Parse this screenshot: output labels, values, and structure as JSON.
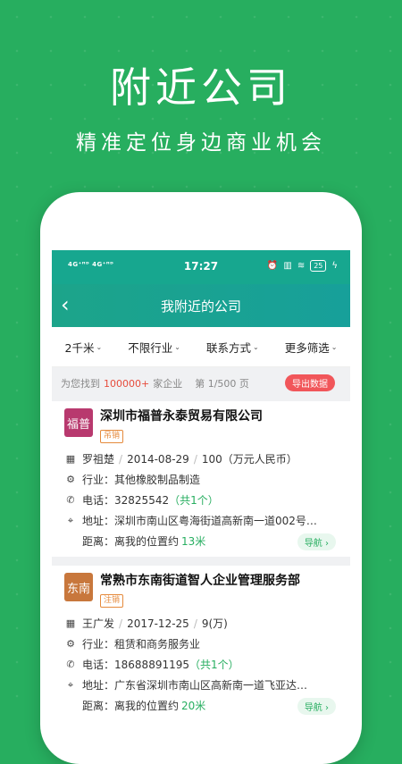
{
  "promo": {
    "title": "附近公司",
    "subtitle": "精准定位身边商业机会"
  },
  "statusbar": {
    "left": "4G⁺ᴴᴰ 4G⁺ᴴᴰ",
    "time": "17:27",
    "battery": "25"
  },
  "nav": {
    "title": "我附近的公司"
  },
  "filters": [
    {
      "label": "2千米"
    },
    {
      "label": "不限行业"
    },
    {
      "label": "联系方式"
    },
    {
      "label": "更多筛选"
    }
  ],
  "result": {
    "prefix": "为您找到",
    "count": "100000+",
    "suffix": "家企业",
    "page": "第 1/500 页",
    "export_label": "导出数据"
  },
  "companies": [
    {
      "logo_text": "福普",
      "logo_color": "#b8396e",
      "name": "深圳市福普永泰贸易有限公司",
      "tag": "吊销",
      "person": "罗祖楚",
      "date": "2014-08-29",
      "capital": "100（万元人民币）",
      "industry_label": "行业：",
      "industry": "其他橡胶制品制造",
      "phone_label": "电话：",
      "phone": "32825542",
      "phone_count": "（共1个）",
      "address_label": "地址：",
      "address": "深圳市南山区粤海街道高新南一道002号…",
      "distance_label": "距离：",
      "distance_text": "离我的位置约",
      "distance": "13米",
      "nav_label": "导航 ›"
    },
    {
      "logo_text": "东南",
      "logo_color": "#c8773c",
      "name": "常熟市东南街道智人企业管理服务部",
      "tag": "注销",
      "person": "王广发",
      "date": "2017-12-25",
      "capital": "9(万)",
      "industry_label": "行业：",
      "industry": "租赁和商务服务业",
      "phone_label": "电话：",
      "phone": "18688891195",
      "phone_count": "（共1个）",
      "address_label": "地址：",
      "address": "广东省深圳市南山区高新南一道飞亚达…",
      "distance_label": "距离：",
      "distance_text": "离我的位置约",
      "distance": "20米",
      "nav_label": "导航 ›"
    }
  ],
  "icons": {
    "person": "building-person-icon",
    "industry": "gear-icon",
    "phone": "phone-icon",
    "address": "location-pin-icon"
  },
  "colors": {
    "background_green": "#27ae5f",
    "header_teal": "#1ca48a",
    "accent_red": "#f1565a",
    "accent_green": "#27ae60"
  }
}
